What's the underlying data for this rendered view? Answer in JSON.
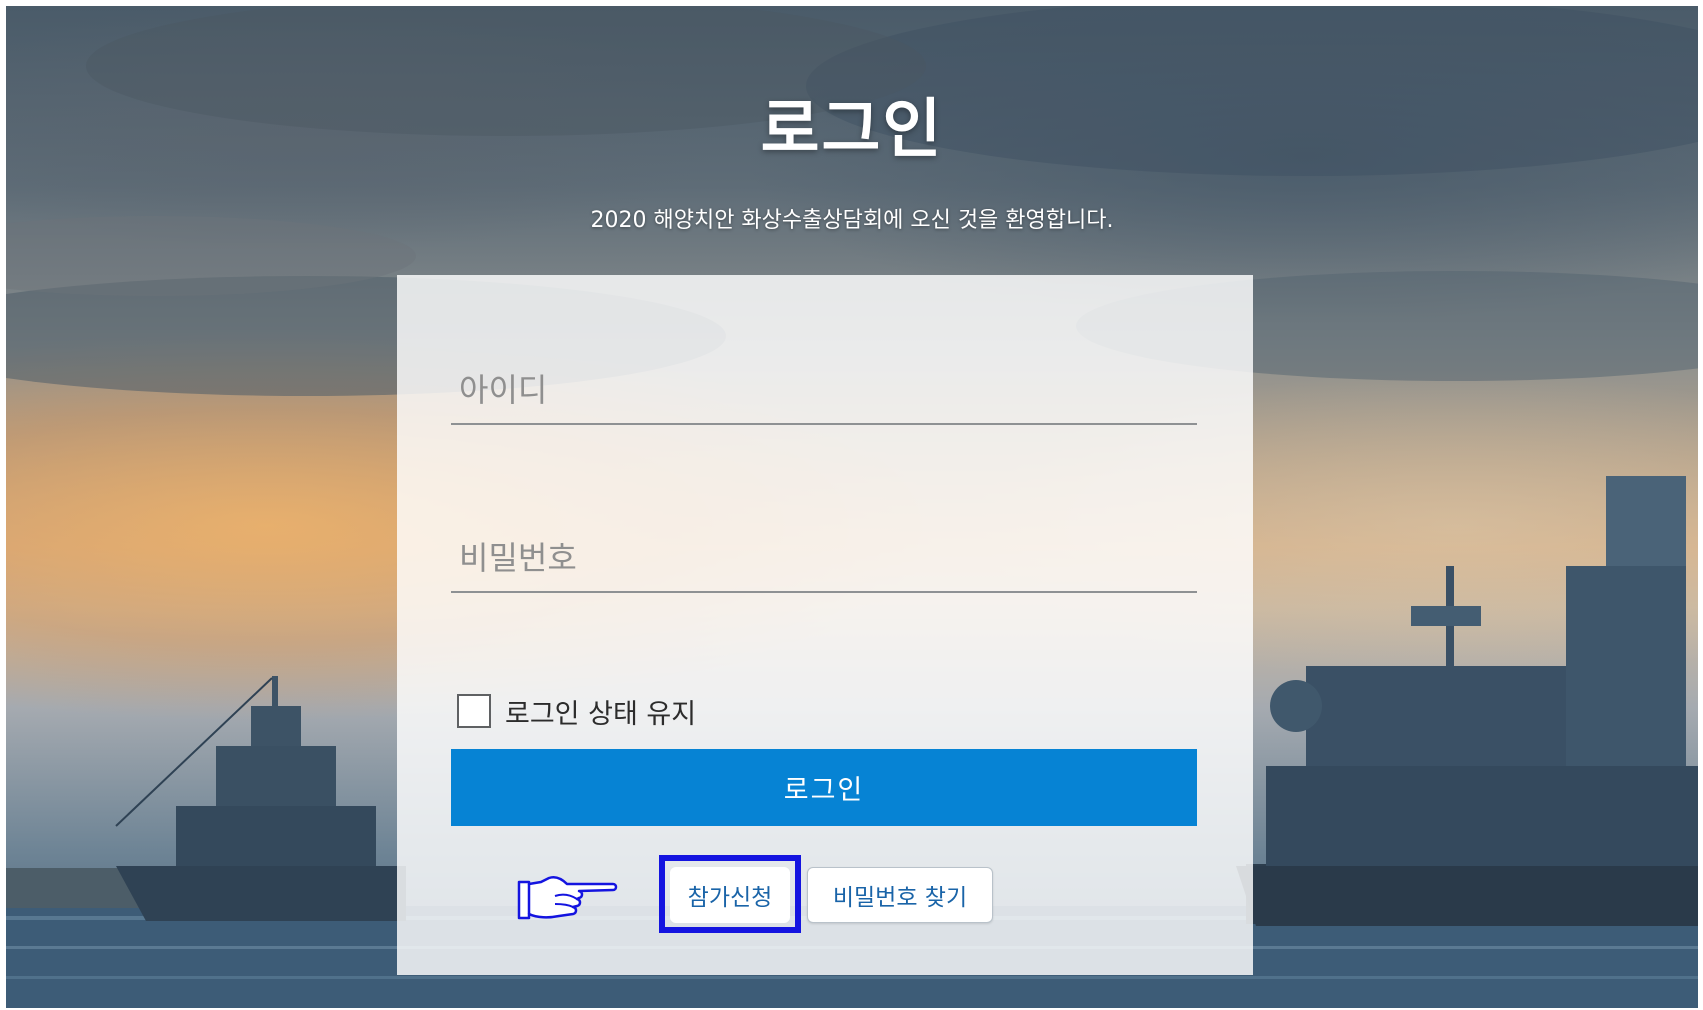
{
  "page": {
    "title": "로그인",
    "subtitle": "2020 해양치안 화상수출상담회에 오신 것을 환영합니다."
  },
  "form": {
    "id_placeholder": "아이디",
    "password_placeholder": "비밀번호",
    "remember_label": "로그인 상태 유지",
    "remember_checked": false,
    "login_label": "로그인"
  },
  "links": {
    "join_label": "참가신청",
    "find_password_label": "비밀번호 찾기"
  },
  "annotation": {
    "pointer_icon": "pointing-hand-icon",
    "highlight_color": "#1414e0"
  },
  "colors": {
    "primary": "#0683d4",
    "link_text": "#1a64a8"
  }
}
